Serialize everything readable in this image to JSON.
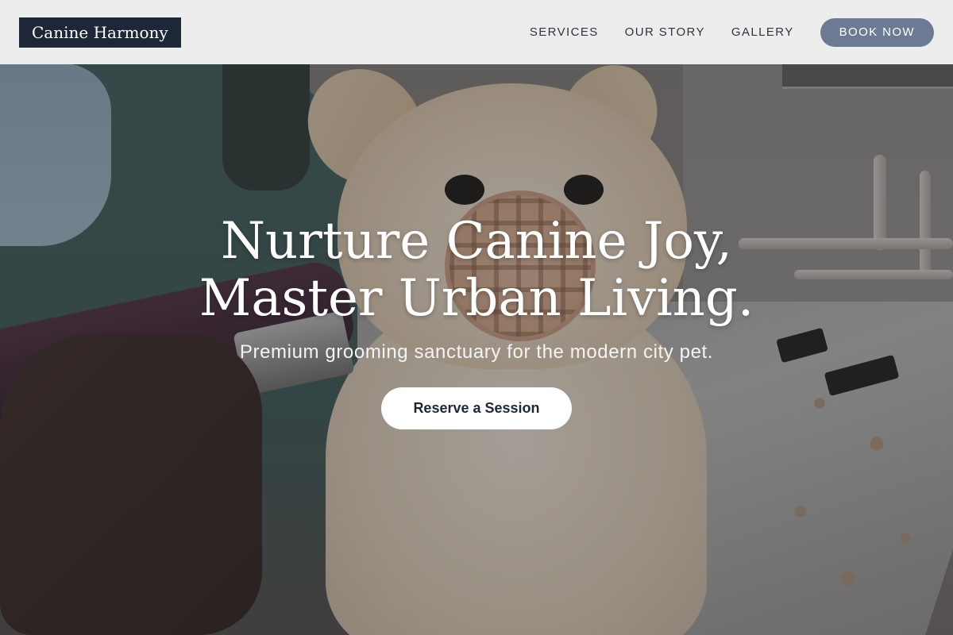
{
  "brand": {
    "name": "Canine Harmony"
  },
  "nav": {
    "links": [
      "SERVICES",
      "OUR STORY",
      "GALLERY"
    ],
    "book_label": "BOOK NOW"
  },
  "hero": {
    "title_line1": "Nurture Canine Joy,",
    "title_line2": "Master Urban Living.",
    "subtitle": "Premium grooming sanctuary for the modern city pet.",
    "cta_label": "Reserve a Session"
  },
  "colors": {
    "brand_dark": "#1e2738",
    "accent": "#6c7b93",
    "navbar_bg": "#f4f4f4"
  }
}
